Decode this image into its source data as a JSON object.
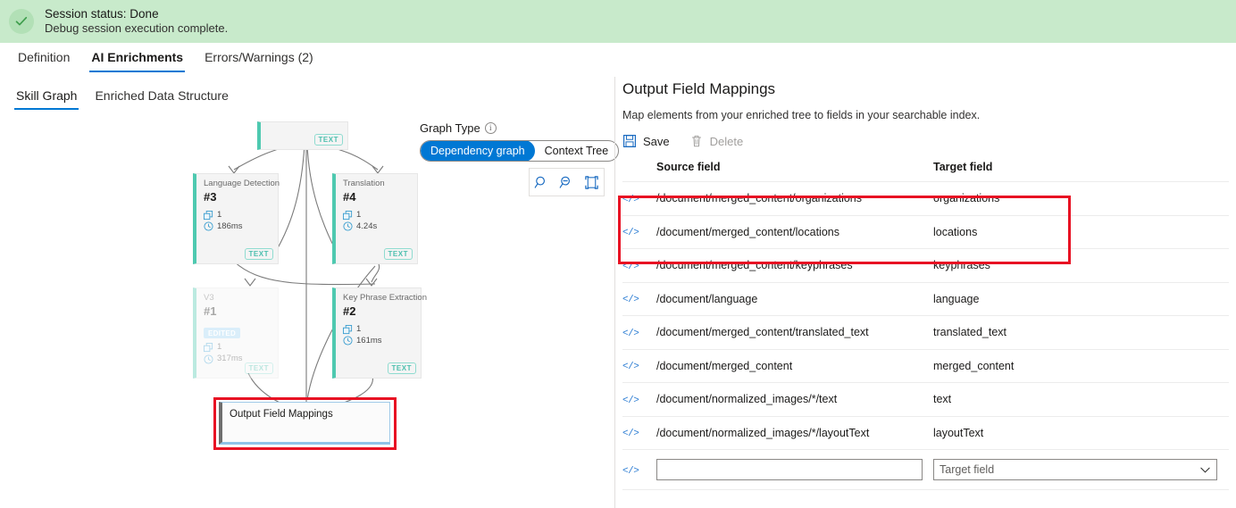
{
  "status": {
    "icon": "check-circle-icon",
    "title": "Session status: Done",
    "subtitle": "Debug session execution complete.",
    "bg_color": "#c8eacb"
  },
  "primary_tabs": [
    {
      "label": "Definition",
      "active": false
    },
    {
      "label": "AI Enrichments",
      "active": true
    },
    {
      "label": "Errors/Warnings (2)",
      "active": false
    }
  ],
  "secondary_tabs": [
    {
      "label": "Skill Graph",
      "active": true
    },
    {
      "label": "Enriched Data Structure",
      "active": false
    }
  ],
  "graph": {
    "type_label": "Graph Type",
    "info_icon": "info-icon",
    "options": [
      {
        "label": "Dependency graph",
        "active": true
      },
      {
        "label": "Context Tree",
        "active": false
      }
    ],
    "zoom_controls": [
      {
        "name": "zoom-in-icon"
      },
      {
        "name": "zoom-out-icon"
      },
      {
        "name": "fit-to-screen-icon"
      }
    ],
    "nodes": [
      {
        "id": "root",
        "title": "",
        "num": "",
        "badge": "",
        "count": "",
        "time": "",
        "tag": "TEXT",
        "faded": false
      },
      {
        "id": "lang",
        "title": "Language Detection",
        "num": "#3",
        "badge": "",
        "count": "1",
        "time": "186ms",
        "tag": "TEXT",
        "faded": false
      },
      {
        "id": "transl",
        "title": "Translation",
        "num": "#4",
        "badge": "",
        "count": "1",
        "time": "4.24s",
        "tag": "TEXT",
        "faded": false
      },
      {
        "id": "v3",
        "title": "V3",
        "num": "#1",
        "badge": "EDITED",
        "count": "1",
        "time": "317ms",
        "tag": "TEXT",
        "faded": true
      },
      {
        "id": "kpe",
        "title": "Key Phrase Extraction",
        "num": "#2",
        "badge": "",
        "count": "1",
        "time": "161ms",
        "tag": "TEXT",
        "faded": false
      }
    ],
    "output_node_label": "Output Field Mappings",
    "highlight_color": "#e81123"
  },
  "panel": {
    "title": "Output Field Mappings",
    "subtitle": "Map elements from your enriched tree to fields in your searchable index.",
    "commands": [
      {
        "label": "Save",
        "icon": "save-icon",
        "disabled": false
      },
      {
        "label": "Delete",
        "icon": "trash-icon",
        "disabled": true
      }
    ],
    "columns": {
      "source": "Source field",
      "target": "Target field"
    },
    "rows": [
      {
        "source": "/document/merged_content/organizations",
        "target": "organizations",
        "highlighted": true
      },
      {
        "source": "/document/merged_content/locations",
        "target": "locations",
        "highlighted": true
      },
      {
        "source": "/document/merged_content/keyphrases",
        "target": "keyphrases",
        "highlighted": false
      },
      {
        "source": "/document/language",
        "target": "language",
        "highlighted": false
      },
      {
        "source": "/document/merged_content/translated_text",
        "target": "translated_text",
        "highlighted": false
      },
      {
        "source": "/document/merged_content",
        "target": "merged_content",
        "highlighted": false
      },
      {
        "source": "/document/normalized_images/*/text",
        "target": "text",
        "highlighted": false
      },
      {
        "source": "/document/normalized_images/*/layoutText",
        "target": "layoutText",
        "highlighted": false
      }
    ],
    "new_row": {
      "source_value": "",
      "source_placeholder": "",
      "target_placeholder": "Target field",
      "chevron_icon": "chevron-down-icon"
    }
  },
  "colors": {
    "accent": "#0078d4",
    "highlight": "#e81123",
    "node_accent": "#4ec9b0",
    "code_icon": "#2b7cd3"
  }
}
